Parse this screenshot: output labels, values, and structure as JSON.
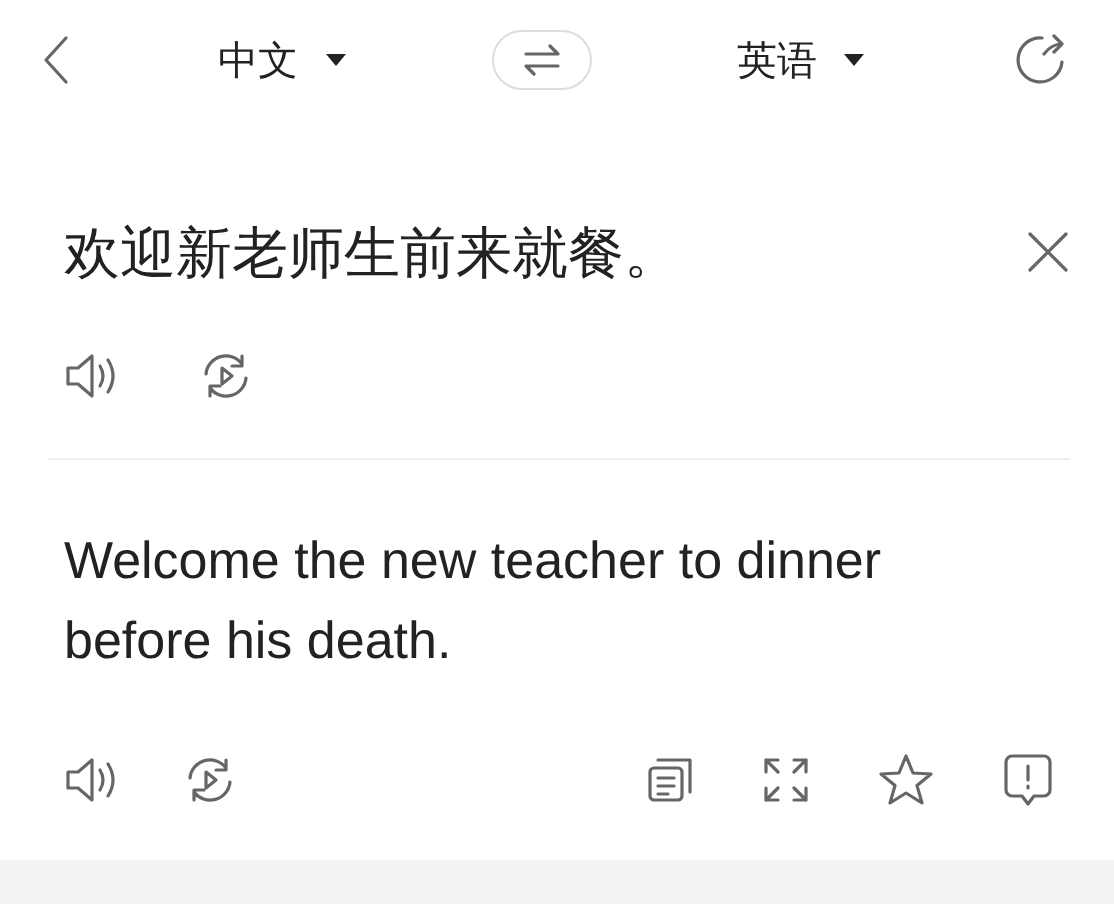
{
  "header": {
    "source_language": "中文",
    "target_language": "英语"
  },
  "source": {
    "text": "欢迎新老师生前来就餐。"
  },
  "translation": {
    "text": "Welcome the new teacher to dinner before his death."
  }
}
